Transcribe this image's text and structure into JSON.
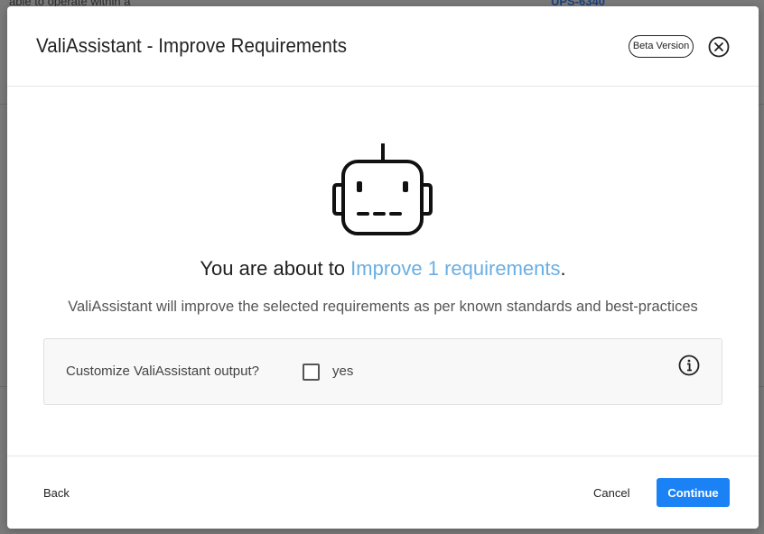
{
  "background": {
    "text": "able to operate within a",
    "link": "UPS-6340"
  },
  "modal": {
    "title": "ValiAssistant - Improve Requirements",
    "badge": "Beta Version",
    "icons": {
      "close": "close-circle-icon",
      "robot": "robot-icon",
      "info": "info-icon"
    },
    "headline_prefix": "You are about to ",
    "headline_accent": "Improve 1 requirements",
    "headline_suffix": ".",
    "description": "ValiAssistant will improve the selected requirements as per known standards and best-practices",
    "option_label": "Customize ValiAssistant output?",
    "checkbox_label": "yes",
    "checkbox_checked": false
  },
  "footer": {
    "back": "Back",
    "cancel": "Cancel",
    "continue": "Continue"
  },
  "colors": {
    "accent": "#6aaee3",
    "primary_button": "#1a82f5"
  }
}
